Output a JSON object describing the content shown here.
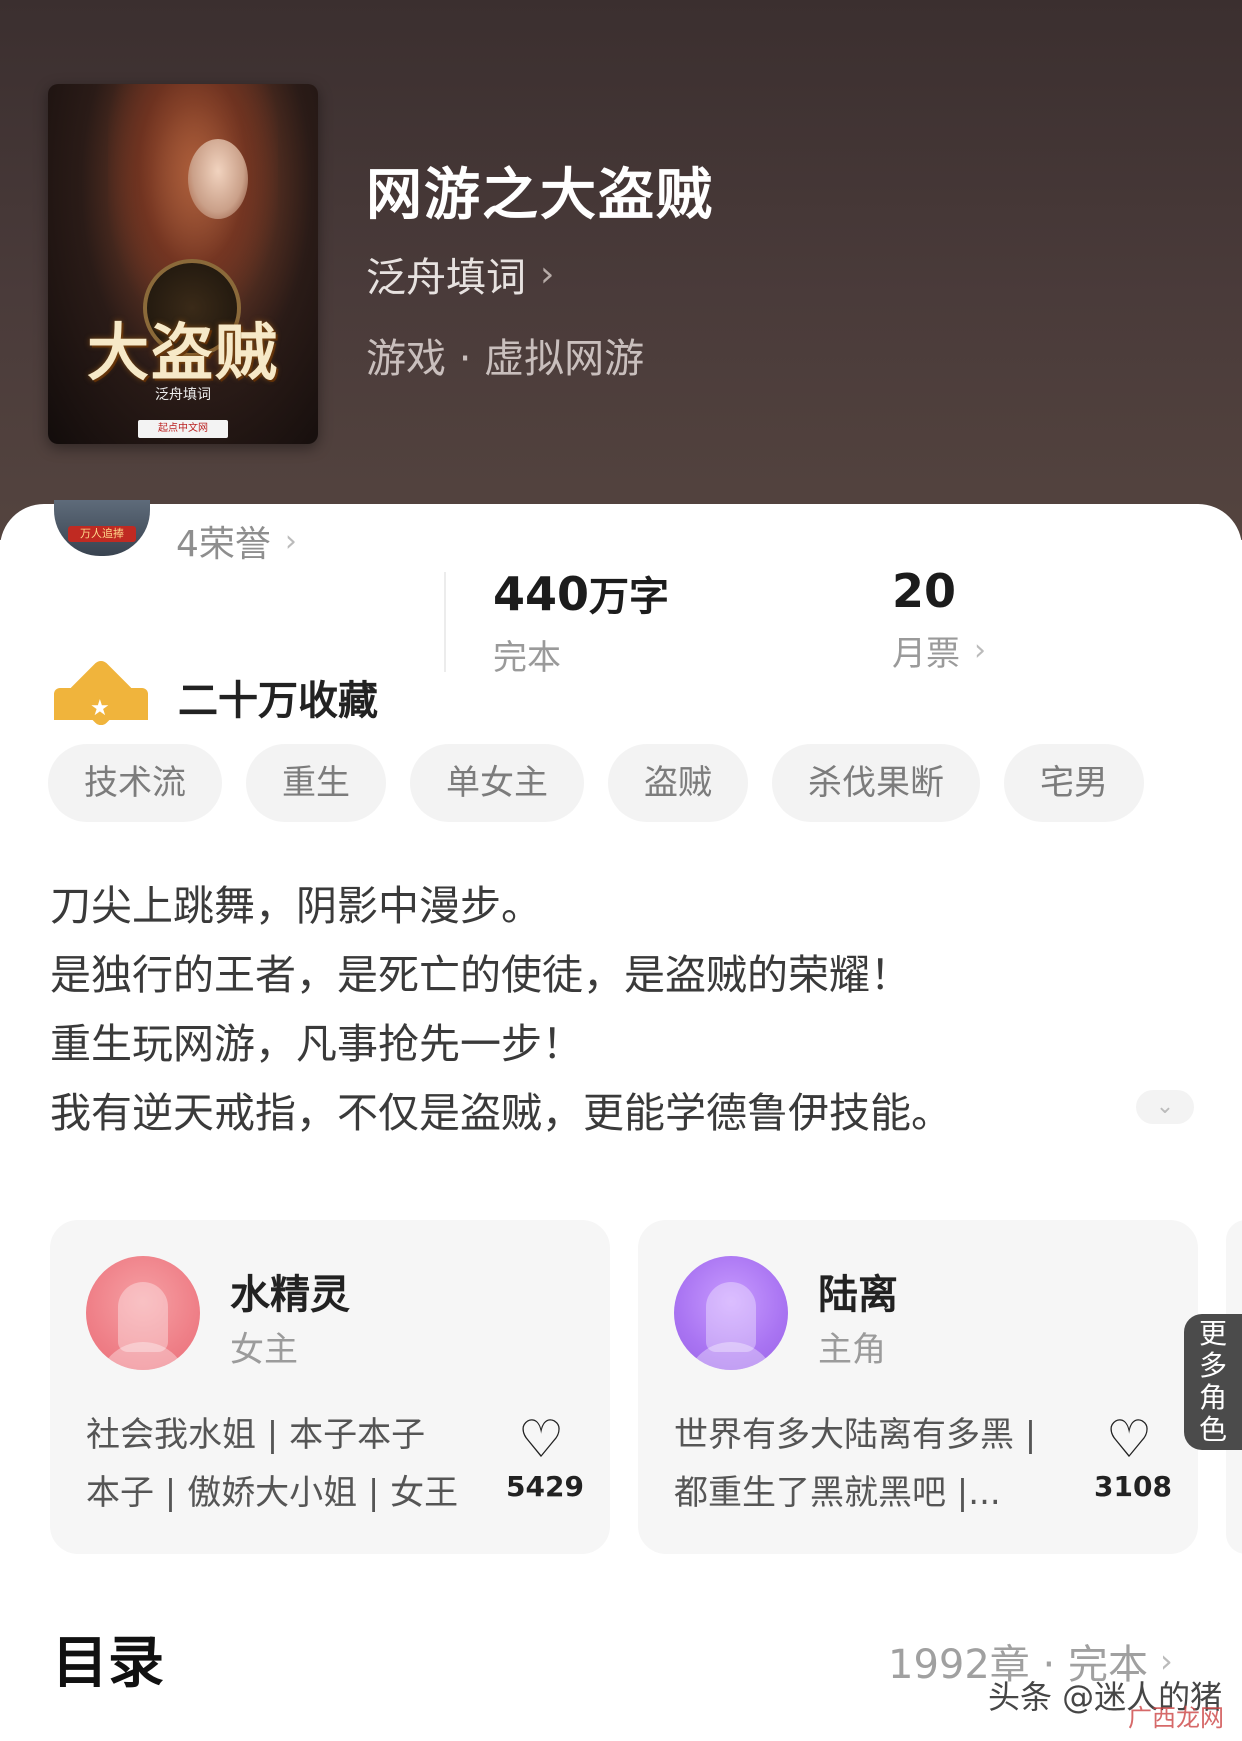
{
  "book": {
    "cover_title": "大盗贼",
    "cover_author": "泛舟填词",
    "cover_publisher": "起点中文网",
    "title": "网游之大盗贼",
    "author": "泛舟填词",
    "genre": "游戏 · 虚拟网游"
  },
  "honors": {
    "badge_text": "万人追捧",
    "label": "4荣誉"
  },
  "collection": {
    "label": "二十万收藏"
  },
  "stats": {
    "words_value": "440",
    "words_unit": "万字",
    "words_label": "完本",
    "votes_value": "20",
    "votes_label": "月票"
  },
  "tags": [
    "技术流",
    "重生",
    "单女主",
    "盗贼",
    "杀伐果断",
    "宅男"
  ],
  "synopsis": [
    "刀尖上跳舞，阴影中漫步。",
    "是独行的王者，是死亡的使徒，是盗贼的荣耀！",
    "重生玩网游，凡事抢先一步！",
    "我有逆天戒指，不仅是盗贼，更能学德鲁伊技能。"
  ],
  "roles": [
    {
      "name": "水精灵",
      "type": "女主",
      "desc_line1": "社会我水姐 | 本子本子",
      "desc_line2": "本子 | 傲娇大小姐 | 女王",
      "likes": "5429"
    },
    {
      "name": "陆离",
      "type": "主角",
      "desc_line1": "世界有多大陆离有多黑 |",
      "desc_line2": "都重生了黑就黑吧 |...",
      "likes": "3108"
    }
  ],
  "more_roles": [
    "更",
    "多",
    "角",
    "色"
  ],
  "toc": {
    "title": "目录",
    "meta": "1992章 · 完本"
  },
  "watermark": "头条 @迷人的猪",
  "watermark_site": "广西龙网",
  "colors": {
    "header_bg": "#3b2f2f",
    "crown": "#f0b43c",
    "avatar_pink": "#ef8088",
    "avatar_purple": "#a974f2"
  },
  "icons": [
    "chevron-right-icon",
    "crown-icon",
    "heart-icon",
    "chevron-down-icon",
    "honor-badge-icon"
  ]
}
